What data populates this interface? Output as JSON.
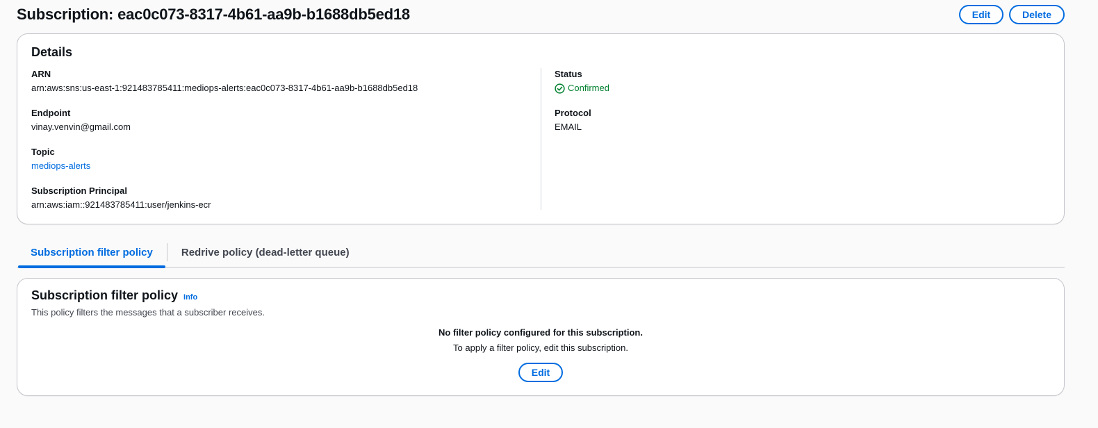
{
  "header": {
    "title": "Subscription: eac0c073-8317-4b61-aa9b-b1688db5ed18",
    "edit_label": "Edit",
    "delete_label": "Delete"
  },
  "details": {
    "heading": "Details",
    "arn_label": "ARN",
    "arn_value": "arn:aws:sns:us-east-1:921483785411:mediops-alerts:eac0c073-8317-4b61-aa9b-b1688db5ed18",
    "endpoint_label": "Endpoint",
    "endpoint_value": "vinay.venvin@gmail.com",
    "topic_label": "Topic",
    "topic_value": "mediops-alerts",
    "principal_label": "Subscription Principal",
    "principal_value": "arn:aws:iam::921483785411:user/jenkins-ecr",
    "status_label": "Status",
    "status_value": "Confirmed",
    "protocol_label": "Protocol",
    "protocol_value": "EMAIL"
  },
  "tabs": [
    {
      "label": "Subscription filter policy",
      "active": true
    },
    {
      "label": "Redrive policy (dead-letter queue)",
      "active": false
    }
  ],
  "filter_policy": {
    "heading": "Subscription filter policy",
    "info_label": "Info",
    "description": "This policy filters the messages that a subscriber receives.",
    "empty_title": "No filter policy configured for this subscription.",
    "empty_text": "To apply a filter policy, edit this subscription.",
    "edit_label": "Edit"
  },
  "icons": {
    "status": "check-circle-icon"
  },
  "colors": {
    "accent": "#006ce0",
    "success": "#00802f",
    "border": "#c6c6cd",
    "background": "#fafafa"
  }
}
